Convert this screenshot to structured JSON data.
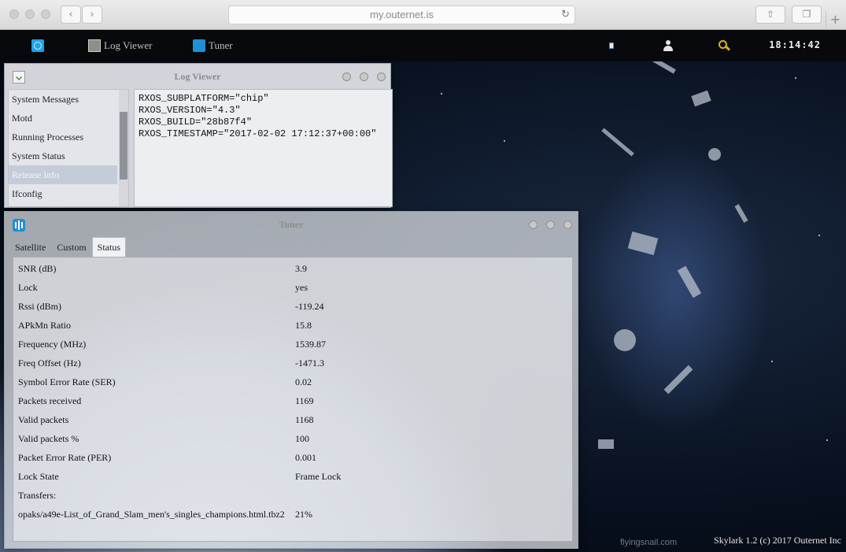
{
  "browser": {
    "url": "my.outernet.is"
  },
  "topbar": {
    "apps": [
      {
        "label": "Log Viewer",
        "icon": "log-viewer-icon"
      },
      {
        "label": "Tuner",
        "icon": "tuner-icon"
      }
    ],
    "clock": "18:14:42",
    "icons": [
      "network-icon",
      "user-icon",
      "search-icon"
    ],
    "accent": "#1fa3e6"
  },
  "log_viewer": {
    "title": "Log Viewer",
    "items": [
      "System Messages",
      "Motd",
      "Running Processes",
      "System Status",
      "Release Info",
      "Ifconfig"
    ],
    "selected": "Release Info",
    "content": "RXOS_SUBPLATFORM=\"chip\"\nRXOS_VERSION=\"4.3\"\nRXOS_BUILD=\"28b87f4\"\nRXOS_TIMESTAMP=\"2017-02-02 17:12:37+00:00\""
  },
  "tuner": {
    "title": "Tuner",
    "tabs": [
      "Satellite",
      "Custom",
      "Status"
    ],
    "active_tab": "Status",
    "rows": [
      {
        "key": "SNR (dB)",
        "value": "3.9"
      },
      {
        "key": "Lock",
        "value": "yes"
      },
      {
        "key": "Rssi (dBm)",
        "value": "-119.24"
      },
      {
        "key": "APkMn Ratio",
        "value": "15.8"
      },
      {
        "key": "Frequency (MHz)",
        "value": "1539.87"
      },
      {
        "key": "Freq Offset (Hz)",
        "value": "-1471.3"
      },
      {
        "key": "Symbol Error Rate (SER)",
        "value": "0.02"
      },
      {
        "key": "Packets received",
        "value": "1169"
      },
      {
        "key": "Valid packets",
        "value": "1168"
      },
      {
        "key": "Valid packets %",
        "value": "100"
      },
      {
        "key": "Packet Error Rate (PER)",
        "value": "0.001"
      },
      {
        "key": "Lock State",
        "value": "Frame Lock"
      },
      {
        "key": "Transfers:",
        "value": ""
      },
      {
        "key": "opaks/a49e-List_of_Grand_Slam_men's_singles_champions.html.tbz2",
        "value": "21%"
      }
    ]
  },
  "watermark": "flyingsnail.com",
  "footer": "Skylark 1.2 (c) 2017 Outernet Inc"
}
